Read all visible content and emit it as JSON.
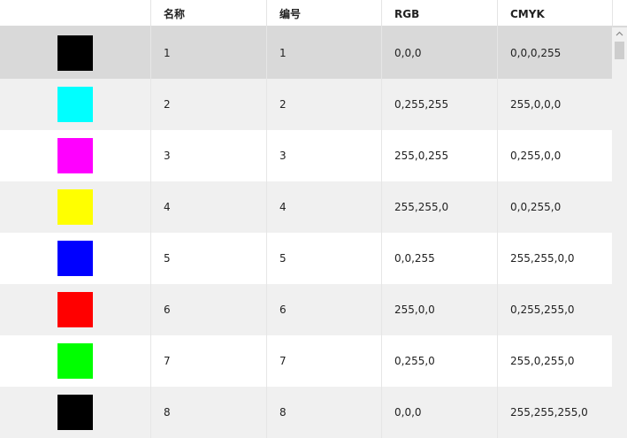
{
  "columns": [
    "",
    "名称",
    "编号",
    "RGB",
    "CMYK"
  ],
  "rows": [
    {
      "color": "#000000",
      "name": "1",
      "number": "1",
      "rgb": "0,0,0",
      "cmyk": "0,0,0,255"
    },
    {
      "color": "#00ffff",
      "name": "2",
      "number": "2",
      "rgb": "0,255,255",
      "cmyk": "255,0,0,0"
    },
    {
      "color": "#ff00ff",
      "name": "3",
      "number": "3",
      "rgb": "255,0,255",
      "cmyk": "0,255,0,0"
    },
    {
      "color": "#ffff00",
      "name": "4",
      "number": "4",
      "rgb": "255,255,0",
      "cmyk": "0,0,255,0"
    },
    {
      "color": "#0000ff",
      "name": "5",
      "number": "5",
      "rgb": "0,0,255",
      "cmyk": "255,255,0,0"
    },
    {
      "color": "#ff0000",
      "name": "6",
      "number": "6",
      "rgb": "255,0,0",
      "cmyk": "0,255,255,0"
    },
    {
      "color": "#00ff00",
      "name": "7",
      "number": "7",
      "rgb": "0,255,0",
      "cmyk": "255,0,255,0"
    },
    {
      "color": "#000000",
      "name": "8",
      "number": "8",
      "rgb": "0,0,0",
      "cmyk": "255,255,255,0"
    }
  ],
  "selected_row": 1,
  "icons": {
    "scroll_up": "chevron-up-icon"
  }
}
